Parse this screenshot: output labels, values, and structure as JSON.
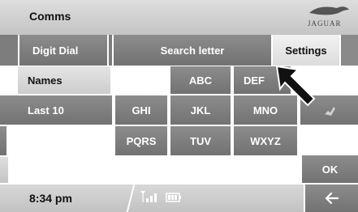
{
  "header": {
    "title": "Comms",
    "brand": "JAGUAR"
  },
  "tabs": {
    "digit_dial": "Digit Dial",
    "search_letter": "Search letter",
    "settings": "Settings"
  },
  "sidebar": {
    "names": "Names",
    "last10": "Last 10"
  },
  "keypad": {
    "row1": [
      "ABC",
      "DEF"
    ],
    "row2": [
      "GHI",
      "JKL",
      "MNO"
    ],
    "row3": [
      "PQRS",
      "TUV",
      "WXYZ"
    ]
  },
  "actions": {
    "ok": "OK"
  },
  "status": {
    "time": "8:34 pm"
  },
  "icons": {
    "back": "back-arrow-icon",
    "signal": "signal-strength-icon",
    "battery": "battery-icon",
    "emblem": "jaguar-leaper-icon",
    "phone": "phone-icon"
  }
}
